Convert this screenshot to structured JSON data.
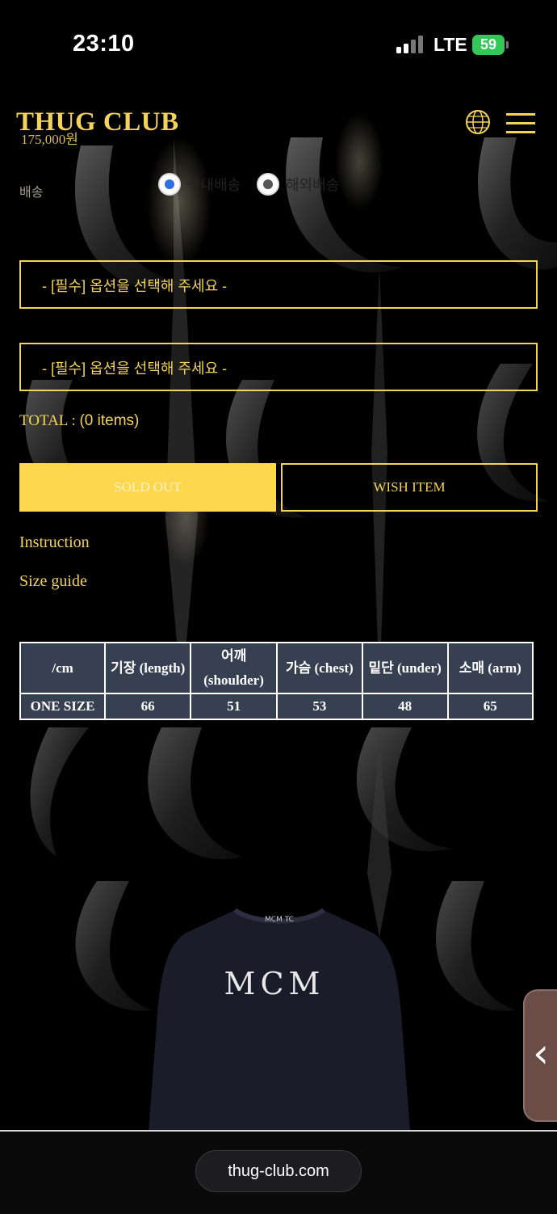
{
  "status_bar": {
    "time": "23:10",
    "network": "LTE",
    "battery": "59"
  },
  "header": {
    "brand": "THUG CLUB",
    "price": "175,000원",
    "globe_icon": "globe-icon",
    "menu_icon": "hamburger-menu-icon"
  },
  "shipping": {
    "label": "배송",
    "options": [
      {
        "label": "국내배송",
        "selected": true
      },
      {
        "label": "해외배송",
        "selected": false
      }
    ]
  },
  "options": {
    "select1_placeholder": "- [필수] 옵션을 선택해 주세요 -",
    "select2_placeholder": "- [필수] 옵션을 선택해 주세요 -"
  },
  "total": {
    "label": "TOTAL : ",
    "items": "(0 items)"
  },
  "buttons": {
    "sold_out": "SOLD OUT",
    "wish_item": "WISH ITEM"
  },
  "links": {
    "instruction": "Instruction",
    "size_guide": "Size guide"
  },
  "size_table": {
    "headers": [
      "/cm",
      "기장 (length)",
      "어깨 (shoulder)",
      "가슴 (chest)",
      "밑단 (under)",
      "소매 (arm)"
    ],
    "rows": [
      [
        "ONE SIZE",
        "66",
        "51",
        "53",
        "48",
        "65"
      ]
    ]
  },
  "product_image": {
    "logo_text": "MCM",
    "collar_text": "MCM TC"
  },
  "browser": {
    "url": "thug-club.com",
    "back_icon": "chevron-left-icon"
  },
  "colors": {
    "accent": "#f3d35a",
    "button_fill": "#fdd84f",
    "table_bg": "#374051",
    "background": "#000000"
  }
}
